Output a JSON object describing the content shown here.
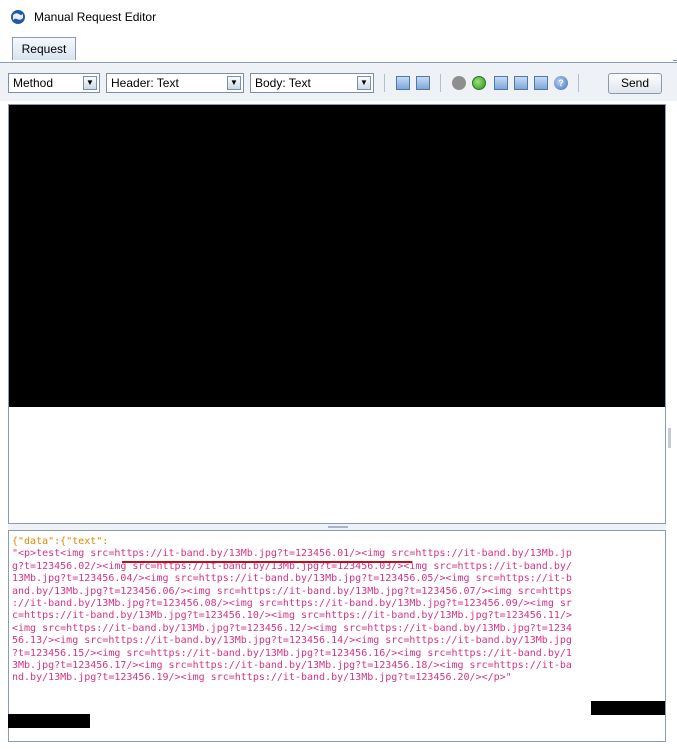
{
  "window": {
    "title": "Manual Request Editor",
    "icon": "app-globe-icon"
  },
  "tabs": [
    {
      "label": "Request",
      "active": true
    }
  ],
  "toolbar": {
    "method": {
      "value": "Method"
    },
    "header": {
      "value": "Header: Text"
    },
    "body": {
      "value": "Body: Text"
    },
    "send_label": "Send"
  },
  "body_text": {
    "key_open": "{\"data\":{\"text\":",
    "lines": [
      "\"<p>test<img src=https://it-band.by/13Mb.jpg?t=123456.01/><img src=https://it-band.by/13Mb.jp",
      "g?t=123456.02/><img src=https://it-band.by/13Mb.jpg?t=123456.03/><img src=https://it-band.by/",
      "13Mb.jpg?t=123456.04/><img src=https://it-band.by/13Mb.jpg?t=123456.05/><img src=https://it-b",
      "and.by/13Mb.jpg?t=123456.06/><img src=https://it-band.by/13Mb.jpg?t=123456.07/><img src=https",
      "://it-band.by/13Mb.jpg?t=123456.08/><img src=https://it-band.by/13Mb.jpg?t=123456.09/><img sr",
      "c=https://it-band.by/13Mb.jpg?t=123456.10/><img src=https://it-band.by/13Mb.jpg?t=123456.11/>",
      "<img src=https://it-band.by/13Mb.jpg?t=123456.12/><img src=https://it-band.by/13Mb.jpg?t=1234",
      "56.13/><img src=https://it-band.by/13Mb.jpg?t=123456.14/><img src=https://it-band.by/13Mb.jpg",
      "?t=123456.15/><img src=https://it-band.by/13Mb.jpg?t=123456.16/><img src=https://it-band.by/1",
      "3Mb.jpg?t=123456.17/><img src=https://it-band.by/13Mb.jpg?t=123456.18/><img src=https://it-ba",
      "nd.by/13Mb.jpg?t=123456.19/><img src=https://it-band.by/13Mb.jpg?t=123456.20/></p>\""
    ]
  },
  "colors": {
    "json_string": "#d63384",
    "json_key": "#e08a00",
    "annotation_underline": "#b8121b"
  }
}
